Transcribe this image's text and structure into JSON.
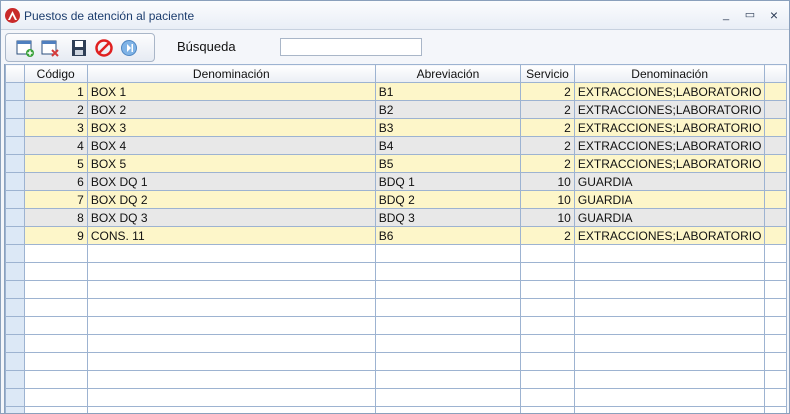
{
  "window": {
    "title": "Puestos de atención al paciente",
    "minimize": "_",
    "maximize": "▭",
    "close": "×"
  },
  "toolbar": {
    "search_label": "Búsqueda",
    "search_value": ""
  },
  "columns": [
    "Código",
    "Denominación",
    "Abreviación",
    "Servicio",
    "Denominación"
  ],
  "rows": [
    {
      "codigo": "1",
      "denominacion": "BOX 1",
      "abreviacion": "B1",
      "servicio": "2",
      "servicio_denominacion": "EXTRACCIONES;LABORATORIO"
    },
    {
      "codigo": "2",
      "denominacion": "BOX 2",
      "abreviacion": "B2",
      "servicio": "2",
      "servicio_denominacion": "EXTRACCIONES;LABORATORIO"
    },
    {
      "codigo": "3",
      "denominacion": "BOX 3",
      "abreviacion": "B3",
      "servicio": "2",
      "servicio_denominacion": "EXTRACCIONES;LABORATORIO"
    },
    {
      "codigo": "4",
      "denominacion": "BOX 4",
      "abreviacion": "B4",
      "servicio": "2",
      "servicio_denominacion": "EXTRACCIONES;LABORATORIO"
    },
    {
      "codigo": "5",
      "denominacion": "BOX 5",
      "abreviacion": "B5",
      "servicio": "2",
      "servicio_denominacion": "EXTRACCIONES;LABORATORIO"
    },
    {
      "codigo": "6",
      "denominacion": "BOX DQ 1",
      "abreviacion": "BDQ 1",
      "servicio": "10",
      "servicio_denominacion": "GUARDIA"
    },
    {
      "codigo": "7",
      "denominacion": "BOX DQ 2",
      "abreviacion": "BDQ 2",
      "servicio": "10",
      "servicio_denominacion": "GUARDIA"
    },
    {
      "codigo": "8",
      "denominacion": "BOX DQ 3",
      "abreviacion": "BDQ 3",
      "servicio": "10",
      "servicio_denominacion": "GUARDIA"
    },
    {
      "codigo": "9",
      "denominacion": "CONS. 11",
      "abreviacion": "B6",
      "servicio": "2",
      "servicio_denominacion": "EXTRACCIONES;LABORATORIO"
    }
  ],
  "colors": {
    "row_odd": "#fdf6c9",
    "row_even": "#e8e8e8",
    "grid_line": "#9db3d1",
    "selector": "#dce8f6",
    "brand_red": "#c92a2a"
  },
  "icons": [
    "new-record-icon",
    "delete-record-icon",
    "save-icon",
    "cancel-icon",
    "next-icon"
  ]
}
